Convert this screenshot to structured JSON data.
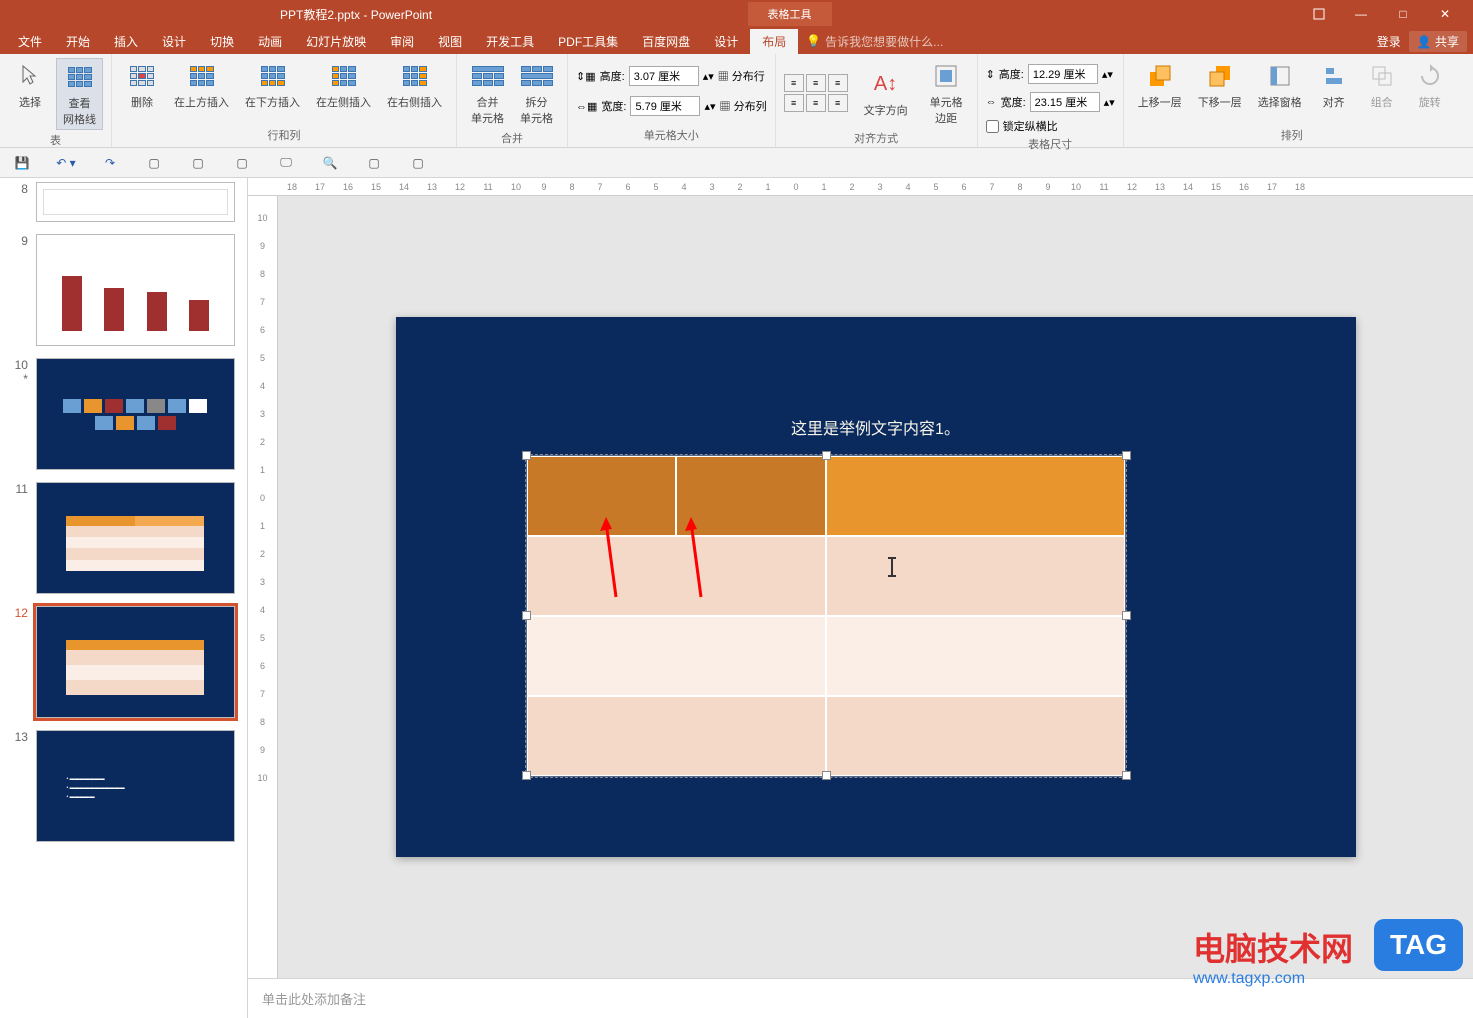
{
  "app": {
    "title": "PPT教程2.pptx - PowerPoint",
    "context_tab": "表格工具"
  },
  "window_controls": {
    "ribbon_opts": "⬚",
    "minimize": "—",
    "maximize": "□",
    "close": "✕"
  },
  "menu": {
    "items": [
      "文件",
      "开始",
      "插入",
      "设计",
      "切换",
      "动画",
      "幻灯片放映",
      "审阅",
      "视图",
      "开发工具",
      "PDF工具集",
      "百度网盘",
      "设计",
      "布局"
    ],
    "active_index": 13,
    "tell_me": "告诉我您想要做什么...",
    "login": "登录",
    "share": "共享"
  },
  "ribbon": {
    "table_group": {
      "select": "选择",
      "gridlines": "查看\n网格线",
      "label": "表"
    },
    "rows_cols": {
      "delete": "删除",
      "insert_above": "在上方插入",
      "insert_below": "在下方插入",
      "insert_left": "在左侧插入",
      "insert_right": "在右侧插入",
      "label": "行和列"
    },
    "merge": {
      "merge_cells": "合并\n单元格",
      "split_cells": "拆分\n单元格",
      "label": "合并"
    },
    "cell_size": {
      "height_label": "高度:",
      "height_val": "3.07 厘米",
      "width_label": "宽度:",
      "width_val": "5.79 厘米",
      "dist_rows": "分布行",
      "dist_cols": "分布列",
      "label": "单元格大小"
    },
    "alignment": {
      "text_dir": "文字方向",
      "margins": "单元格\n边距",
      "label": "对齐方式"
    },
    "table_size": {
      "height_label": "高度:",
      "height_val": "12.29 厘米",
      "width_label": "宽度:",
      "width_val": "23.15 厘米",
      "lock_ratio": "锁定纵横比",
      "label": "表格尺寸"
    },
    "arrange": {
      "bring_fwd": "上移一层",
      "send_back": "下移一层",
      "selection_pane": "选择窗格",
      "align": "对齐",
      "group": "组合",
      "rotate": "旋转",
      "label": "排列"
    }
  },
  "slides": [
    {
      "num": "8"
    },
    {
      "num": "9"
    },
    {
      "num": "10",
      "star": "*"
    },
    {
      "num": "11"
    },
    {
      "num": "12",
      "selected": true
    },
    {
      "num": "13"
    }
  ],
  "ruler_h": [
    "18",
    "17",
    "16",
    "15",
    "14",
    "13",
    "12",
    "11",
    "10",
    "9",
    "8",
    "7",
    "6",
    "5",
    "4",
    "3",
    "2",
    "1",
    "0",
    "1",
    "2",
    "3",
    "4",
    "5",
    "6",
    "7",
    "8",
    "9",
    "10",
    "11",
    "12",
    "13",
    "14",
    "15",
    "16",
    "17",
    "18"
  ],
  "ruler_v": [
    "10",
    "9",
    "8",
    "7",
    "6",
    "5",
    "4",
    "3",
    "2",
    "1",
    "0",
    "1",
    "2",
    "3",
    "4",
    "5",
    "6",
    "7",
    "8",
    "9",
    "10"
  ],
  "slide_content": {
    "title": "这里是举例文字内容1。"
  },
  "notes": {
    "placeholder": "单击此处添加备注"
  },
  "watermark": {
    "text": "电脑技术网",
    "url": "www.tagxp.com",
    "tag": "TAG"
  }
}
